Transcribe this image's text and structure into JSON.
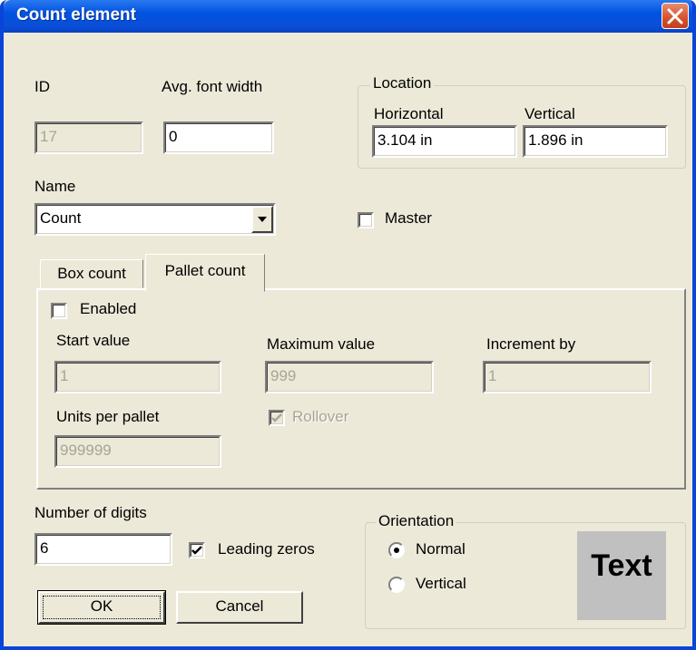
{
  "window": {
    "title": "Count element"
  },
  "fields": {
    "id_label": "ID",
    "id_value": "17",
    "avg_label": "Avg. font width",
    "avg_value": "0",
    "name_label": "Name",
    "name_value": "Count",
    "master_label": "Master"
  },
  "location": {
    "legend": "Location",
    "horizontal_label": "Horizontal",
    "horizontal_value": "3.104 in",
    "vertical_label": "Vertical",
    "vertical_value": "1.896 in"
  },
  "tabs": [
    {
      "label": "Box count",
      "active": false
    },
    {
      "label": "Pallet count",
      "active": true
    }
  ],
  "pallet": {
    "enabled_label": "Enabled",
    "start_label": "Start value",
    "start_value": "1",
    "max_label": "Maximum value",
    "max_value": "999",
    "incr_label": "Increment by",
    "incr_value": "1",
    "units_label": "Units per pallet",
    "units_value": "999999",
    "rollover_label": "Rollover"
  },
  "digits": {
    "label": "Number of digits",
    "value": "6",
    "leading_label": "Leading zeros"
  },
  "orientation": {
    "legend": "Orientation",
    "normal_label": "Normal",
    "vertical_label": "Vertical",
    "preview_text": "Text"
  },
  "buttons": {
    "ok": "OK",
    "cancel": "Cancel"
  },
  "colors": {
    "titlebar": "#0a4fd8",
    "face": "#ece9d8",
    "disabled_text": "#a7a595"
  }
}
